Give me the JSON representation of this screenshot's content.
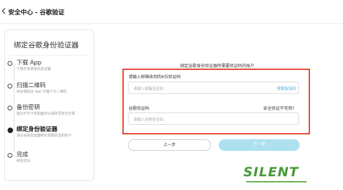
{
  "header": {
    "breadcrumb": [
      "安全中心",
      "-",
      "谷歌验证"
    ]
  },
  "steps_panel": {
    "title": "绑定谷歌身份验证器",
    "steps": [
      {
        "title": "下载 App",
        "desc": "下载并安装身份验证器",
        "active": false
      },
      {
        "title": "扫描二维码",
        "desc": "用谷歌验证 App 扫描下方二维码",
        "active": false
      },
      {
        "title": "备份密钥",
        "desc": "建议手抄下密钥备份以保存至安全位置",
        "active": false
      },
      {
        "title": "绑定身份验证器",
        "desc": "请在谷歌验证器绑定需要验证的账户",
        "active": true
      },
      {
        "title": "完成",
        "desc": "绑定成功",
        "active": false
      }
    ]
  },
  "form": {
    "heading": "绑定谷歌身份验证器所需要验证码的账户",
    "email_code_label": "请输入邮箱收到的6位验证码",
    "email_code_placeholder": "请输入邮箱验证码",
    "get_code_link": "获取验证码",
    "google_code_label": "谷歌验证码",
    "unavailable_link": "安全验证不可用?",
    "google_code_placeholder": "请输入谷歌验证码",
    "prev_button": "上一步",
    "next_button": "下一步"
  },
  "watermark": {
    "text": "SILENT"
  },
  "colors": {
    "highlight_border": "#e34a34",
    "link": "#3aa3d6",
    "next_button_bg": "#aee1ef"
  }
}
